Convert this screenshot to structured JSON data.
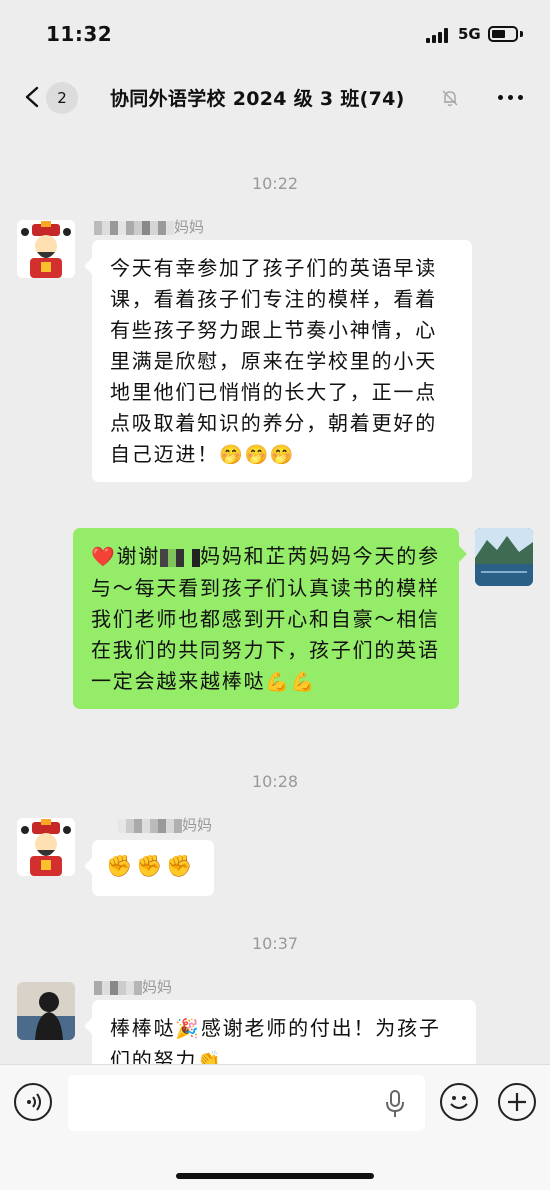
{
  "status_bar": {
    "time": "11:32",
    "network": "5G"
  },
  "nav": {
    "unread_count": "2",
    "title": "协同外语学校 2024 级 3 班(74)",
    "back_icon": "chevron-left-icon",
    "mute_icon": "bell-slash-icon",
    "more_icon": "more-dots-icon"
  },
  "messages": [
    {
      "type": "timestamp",
      "text": "10:22"
    },
    {
      "type": "incoming",
      "avatar": "caishen-avatar",
      "sender_suffix": "妈妈",
      "text": "今天有幸参加了孩子们的英语早读课，看着孩子们专注的模样，看着有些孩子努力跟上节奏小神情，心里满是欣慰，原来在学校里的小天地里他们已悄悄的长大了，正一点点吸取着知识的养分，朝着更好的自己迈进！",
      "emoji": "🤭🤭🤭"
    },
    {
      "type": "outgoing",
      "avatar": "mountain-lake-avatar",
      "lead_emoji": "❤️",
      "text_before": "谢谢",
      "text_after": "妈妈和芷芮妈妈今天的参与～每天看到孩子们认真读书的模样我们老师也都感到开心和自豪～相信在我们的共同努力下，孩子们的英语一定会越来越棒哒",
      "emoji": "💪💪"
    },
    {
      "type": "timestamp",
      "text": "10:28"
    },
    {
      "type": "incoming",
      "avatar": "caishen-avatar",
      "sender_suffix": "妈妈",
      "emoji": "✊✊✊"
    },
    {
      "type": "timestamp",
      "text": "10:37"
    },
    {
      "type": "incoming",
      "avatar": "silhouette-avatar",
      "sender_suffix": "妈妈",
      "text_before": "棒棒哒",
      "emoji_mid": "🎉",
      "text_after": "感谢老师的付出！为孩子们的努力",
      "emoji": "👏"
    }
  ],
  "input_bar": {
    "placeholder": "",
    "voice_icon": "voice-wave-icon",
    "mic_icon": "microphone-icon",
    "emoji_icon": "smiley-icon",
    "plus_icon": "plus-icon"
  },
  "colors": {
    "background": "#ededed",
    "outgoing_bubble": "#95ec69",
    "incoming_bubble": "#ffffff",
    "timestamp": "#999999"
  }
}
